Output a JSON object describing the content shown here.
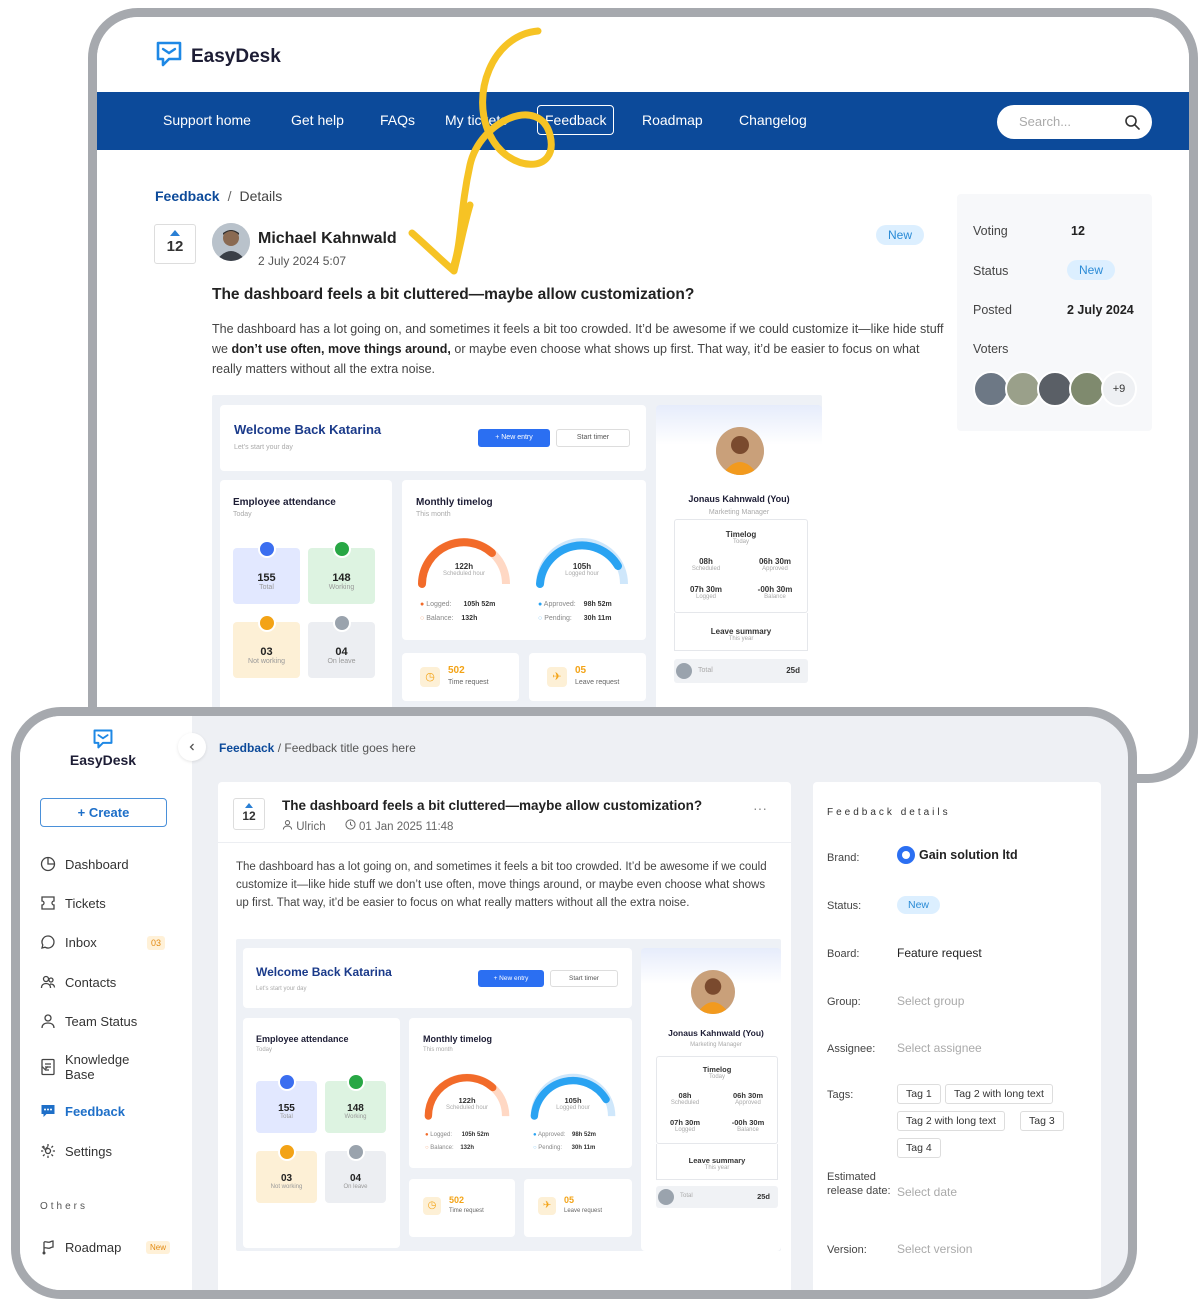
{
  "portal": {
    "brand": "EasyDesk",
    "nav": [
      "Support home",
      "Get help",
      "FAQs",
      "My tickets",
      "Feedback",
      "Roadmap",
      "Changelog"
    ],
    "search_placeholder": "Search...",
    "breadcrumb": {
      "link": "Feedback",
      "sep": "/",
      "current": "Details"
    },
    "post": {
      "votes": "12",
      "author": "Michael Kahnwald",
      "date": "2 July 2024 5:07",
      "status": "New",
      "title": "The dashboard feels a bit cluttered—maybe allow customization?",
      "body_a": "The dashboard has a lot going on, and sometimes it feels a bit too crowded. It’d be awesome if we could customize it—like hide stuff we ",
      "body_b": "don’t use often, move things around,",
      "body_c": " or maybe even choose what shows up first. That way, it’d be easier to focus on what really matters without all the extra noise."
    },
    "sidebar": {
      "voting_label": "Voting",
      "voting_value": "12",
      "status_label": "Status",
      "status_value": "New",
      "posted_label": "Posted",
      "posted_value": "2 July 2024",
      "voters_label": "Voters",
      "voters_more": "+9"
    }
  },
  "dashboard": {
    "welcome": "Welcome Back Katarina",
    "welcome_sub": "Let's start your day",
    "new_entry": "+  New entry",
    "start_timer": "Start timer",
    "attendance_title": "Employee attendance",
    "attendance_sub": "Today",
    "tiles": [
      {
        "n": "155",
        "l": "Total"
      },
      {
        "n": "148",
        "l": "Working"
      },
      {
        "n": "03",
        "l": "Not working"
      },
      {
        "n": "04",
        "l": "On leave"
      }
    ],
    "timelog_title": "Monthly timelog",
    "timelog_sub": "This month",
    "gauge1_value": "122h",
    "gauge1_label": "Scheduled hour",
    "gauge2_value": "105h",
    "gauge2_label": "Logged hour",
    "logged_label": "Logged:",
    "logged_value": "105h 52m",
    "balance_label": "Balance:",
    "balance_value": "132h",
    "approved_label": "Approved:",
    "approved_value": "98h 52m",
    "pending_label": "Pending:",
    "pending_value": "30h 11m",
    "time_req_n": "502",
    "time_req_l": "Time request",
    "leave_req_n": "05",
    "leave_req_l": "Leave request",
    "profile_name": "Jonaus Kahnwald (You)",
    "profile_role": "Marketing Manager",
    "p_timelog": "Timelog",
    "p_today": "Today",
    "p_sched_v": "08h",
    "p_sched_l": "Scheduled",
    "p_appr_v": "06h 30m",
    "p_appr_l": "Approved",
    "p_logged_v": "07h 30m",
    "p_logged_l": "Logged",
    "p_bal_v": "-00h 30m",
    "p_bal_l": "Balance",
    "leave_summary": "Leave summary",
    "this_year": "This year",
    "total_label": "Total",
    "total_value": "25d"
  },
  "admin": {
    "brand": "EasyDesk",
    "create": "+   Create",
    "menu": [
      "Dashboard",
      "Tickets",
      "Inbox",
      "Contacts",
      "Team Status",
      "Knowledge Base",
      "Feedback",
      "Settings"
    ],
    "inbox_badge": "03",
    "others": "Others",
    "roadmap": "Roadmap",
    "roadmap_badge": "New",
    "breadcrumb_link": "Feedback",
    "breadcrumb_rest": " / Feedback title goes here",
    "votes": "12",
    "title": "The dashboard feels a bit cluttered—maybe allow customization?",
    "author": "Ulrich",
    "date": "01 Jan 2025 11:48",
    "more": "···",
    "body": "The dashboard has a lot going on, and sometimes it feels a bit too crowded. It’d be awesome if we could customize it—like hide stuff we don’t use often, move things around, or maybe even choose what shows up first. That way, it’d be easier to focus on what really matters without all the extra noise.",
    "details": {
      "heading": "Feedback details",
      "brand_label": "Brand:",
      "brand_value": "Gain solution ltd",
      "status_label": "Status:",
      "status_value": "New",
      "board_label": "Board:",
      "board_value": "Feature request",
      "group_label": "Group:",
      "group_placeholder": "Select group",
      "assignee_label": "Assignee:",
      "assignee_placeholder": "Select assignee",
      "tags_label": "Tags:",
      "tags": [
        "Tag 1",
        "Tag 2 with long text",
        "Tag 2 with long text",
        "Tag 3",
        "Tag 4"
      ],
      "release_label": "Estimated release date:",
      "release_placeholder": "Select date",
      "version_label": "Version:",
      "version_placeholder": "Select version"
    }
  },
  "colors": {
    "nav": "#0c4a9a",
    "accent": "#1e6fc8",
    "arrow": "#f6c324",
    "new_pill": "#dcefff"
  }
}
